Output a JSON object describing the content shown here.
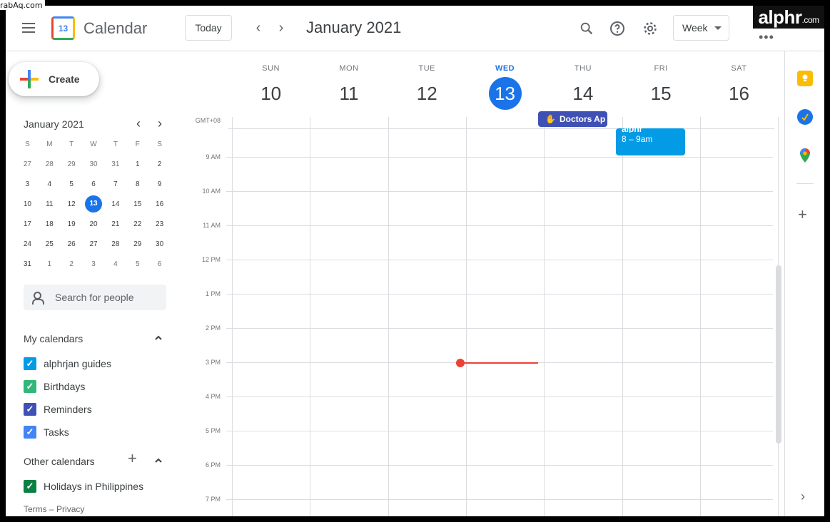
{
  "watermarks": {
    "top_left": "rabAq.com",
    "top_right_brand": "alphr",
    "top_right_tld": ".com"
  },
  "header": {
    "app_logo_day": "13",
    "app_title": "Calendar",
    "today_label": "Today",
    "prev_label": "‹",
    "next_label": "›",
    "current_range": "January 2021",
    "view_label": "Week",
    "more_label": "•••"
  },
  "sidebar": {
    "create_label": "Create",
    "mini_calendar": {
      "title": "January 2021",
      "weekday_heads": [
        "S",
        "M",
        "T",
        "W",
        "T",
        "F",
        "S"
      ],
      "weeks": [
        [
          "27",
          "28",
          "29",
          "30",
          "31",
          "1",
          "2"
        ],
        [
          "3",
          "4",
          "5",
          "6",
          "7",
          "8",
          "9"
        ],
        [
          "10",
          "11",
          "12",
          "13",
          "14",
          "15",
          "16"
        ],
        [
          "17",
          "18",
          "19",
          "20",
          "21",
          "22",
          "23"
        ],
        [
          "24",
          "25",
          "26",
          "27",
          "28",
          "29",
          "30"
        ],
        [
          "31",
          "1",
          "2",
          "3",
          "4",
          "5",
          "6"
        ]
      ],
      "today": "13"
    },
    "people_search_placeholder": "Search for people",
    "my_calendars_title": "My calendars",
    "my_calendars": [
      {
        "label": "alphrjan guides",
        "color": "#039be5"
      },
      {
        "label": "Birthdays",
        "color": "#33b679"
      },
      {
        "label": "Reminders",
        "color": "#3f51b5"
      },
      {
        "label": "Tasks",
        "color": "#4285f4"
      }
    ],
    "other_calendars_title": "Other calendars",
    "other_calendars": [
      {
        "label": "Holidays in Philippines",
        "color": "#0b8043"
      }
    ],
    "footer": {
      "terms": "Terms",
      "separator": "–",
      "privacy": "Privacy"
    }
  },
  "week": {
    "timezone": "GMT+08",
    "days": [
      {
        "name": "SUN",
        "num": "10"
      },
      {
        "name": "MON",
        "num": "11"
      },
      {
        "name": "TUE",
        "num": "12"
      },
      {
        "name": "WED",
        "num": "13",
        "today": true
      },
      {
        "name": "THU",
        "num": "14"
      },
      {
        "name": "FRI",
        "num": "15"
      },
      {
        "name": "SAT",
        "num": "16"
      }
    ],
    "hours": [
      "9 AM",
      "10 AM",
      "11 AM",
      "12 PM",
      "1 PM",
      "2 PM",
      "3 PM",
      "4 PM",
      "5 PM",
      "6 PM",
      "7 PM"
    ],
    "allday_event": {
      "title": "Doctors Ap",
      "color": "#3f51b5"
    },
    "timed_event": {
      "title": "alphr",
      "time": "8 – 9am",
      "color": "#039be5"
    },
    "accent_color": "#1a73e8",
    "now_indicator_color": "#ea4335"
  }
}
